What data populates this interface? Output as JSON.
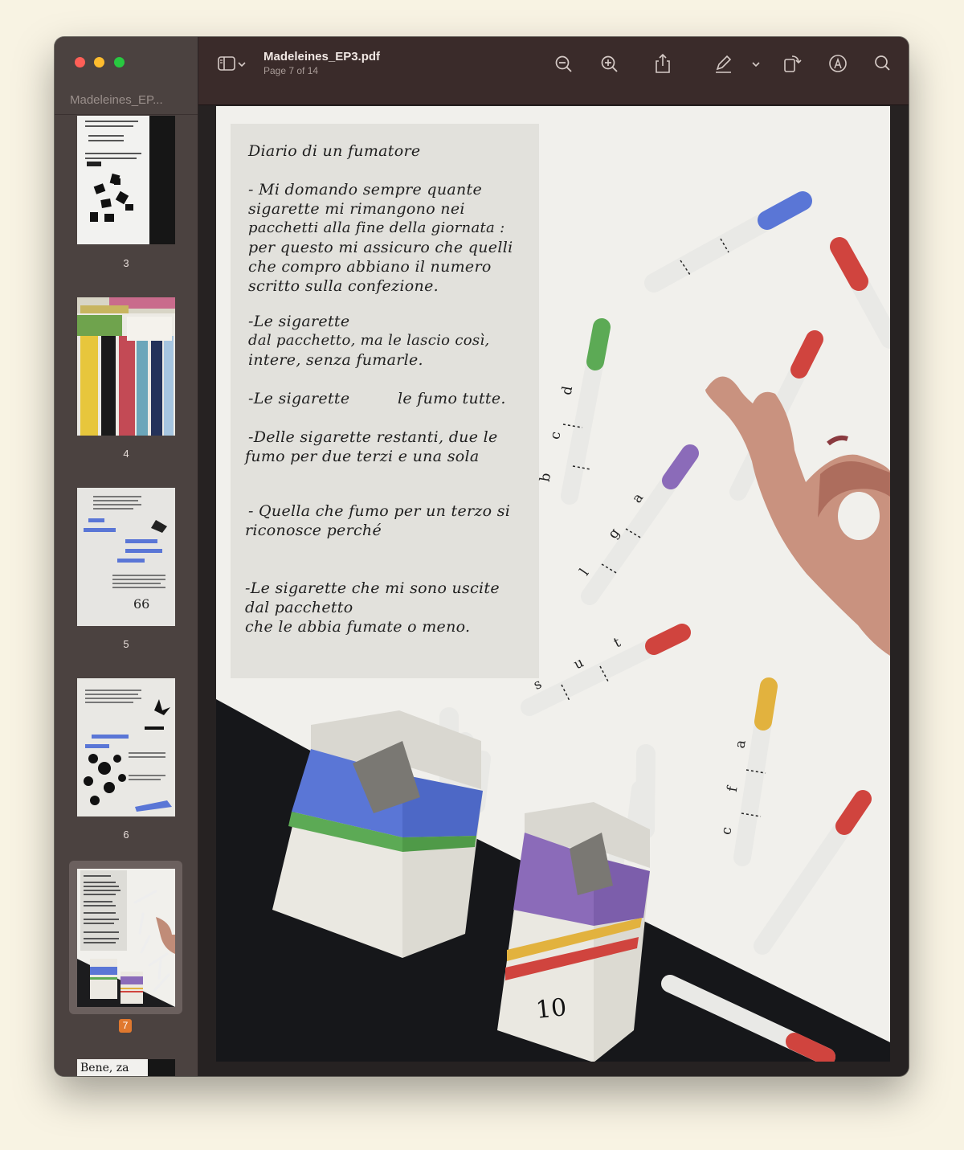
{
  "window": {
    "sidebar_title": "Madeleines_EP...",
    "doc_title": "Madeleines_EP3.pdf",
    "page_indicator": "Page 7 of 14"
  },
  "toolbar": {
    "icons": [
      "sidebar-toggle-icon",
      "chevron-down-icon",
      "zoom-out-icon",
      "zoom-in-icon",
      "share-icon",
      "markup-pen-icon",
      "chevron-down-icon",
      "rotate-icon",
      "annotate-icon",
      "search-icon"
    ]
  },
  "thumbnails": [
    {
      "label": "3"
    },
    {
      "label": "4"
    },
    {
      "label": "5"
    },
    {
      "label": "6"
    },
    {
      "label": "7",
      "selected": true
    },
    {
      "label": "",
      "peek_text": "Bene, za"
    }
  ],
  "page": {
    "note_lines": [
      "Diario di un fumatore",
      "- Mi domando sempre quante",
      "sigarette mi rimangono nei",
      "pacchetti alla fine della giornata :",
      "per questo mi assicuro che quelli",
      "che compro abbiano il numero",
      "scritto sulla confezione.",
      "-Le sigarette",
      "dal pacchetto, ma le lascio così,",
      "intere, senza fumarle.",
      "-Le sigarette",
      "le fumo tutte.",
      "-Delle sigarette restanti, due le",
      "fumo per due terzi e una sola",
      "- Quella che fumo per un terzo si",
      "riconosce perché",
      "-Le sigarette che mi sono uscite",
      "dal pacchetto",
      "che le abbia fumate o meno."
    ],
    "cig_letters": {
      "group1": [
        "b",
        "c",
        "d"
      ],
      "group2": [
        "l",
        "g",
        "a"
      ],
      "group3": [
        "s",
        "u",
        "t"
      ],
      "group4": [
        "c",
        "f",
        "a"
      ]
    },
    "pack_number": "10",
    "colors": {
      "blue": "#5a76d6",
      "green": "#5caa55",
      "purple": "#8b6bb9",
      "red": "#d0443e",
      "yellow": "#e2b23e"
    }
  }
}
